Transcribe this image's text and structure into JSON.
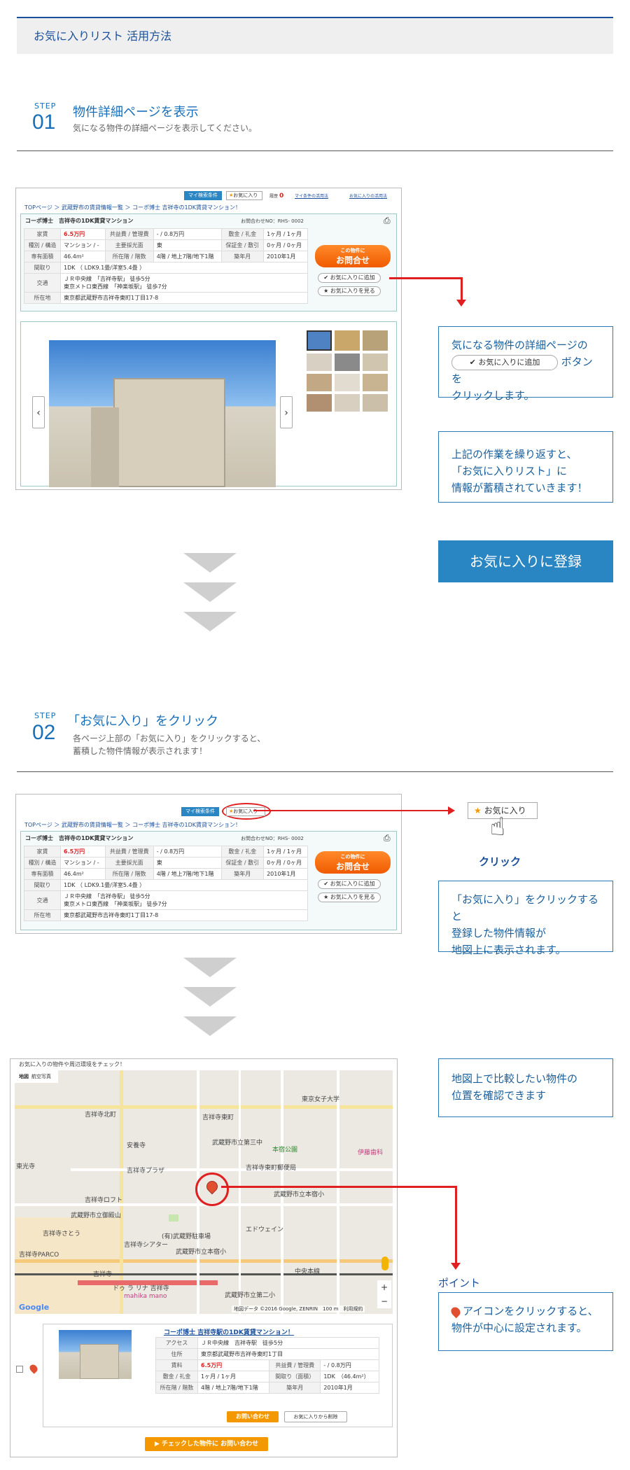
{
  "title": "お気に入りリスト 活用方法",
  "step1": {
    "label": "STEP",
    "num": "01",
    "heading": "物件詳細ページを表示",
    "sub": "気になる物件の詳細ページを表示してください。"
  },
  "step2": {
    "label": "STEP",
    "num": "02",
    "heading": "「お気に入り」をクリック",
    "sub1": "各ページ上部の「お気に入り」をクリックすると、",
    "sub2": "蓄積した物件情報が表示されます！"
  },
  "shot1": {
    "topbtn_my": "マイ検索条件",
    "topbtn_fav": "お気に入り",
    "topbtn_history": "履歴",
    "history_count": "0",
    "topbtn_mycond": "マイ条件の活用法",
    "topbtn_favuse": "お気に入りの活用法",
    "breadcrumb": "TOPページ ＞ 武蔵野市の賃貸情報一覧 ＞ コーポ博士 吉祥寺の1DK賃貸マンション！",
    "name": "コーポ博士　吉祥寺の1DK賃貸マンション",
    "inquiry_no": "お問合わせNO：RHS- 0002",
    "rent_lbl": "家賃",
    "rent": "6.5万円",
    "fee_lbl": "共益費 / 管理費",
    "fee": "- / 0.8万円",
    "deposit_lbl": "敷金 / 礼金",
    "deposit": "1ヶ月 / 1ヶ月",
    "type_lbl": "種別 / 構造",
    "type": "マンション / -",
    "dir_lbl": "主要採光面",
    "dir": "東",
    "guar_lbl": "保証金 / 敷引",
    "guar": "0ヶ月 / 0ヶ月",
    "area_lbl": "専有面積",
    "area": "46.4m²",
    "floor_lbl": "所在階 / 階数",
    "floor": "4階 / 地上7階/地下1階",
    "built_lbl": "築年月",
    "built": "2010年1月",
    "layout_lbl": "間取り",
    "layout": "1DK （ LDK9.1畳/洋室5.4畳 ）",
    "access_lbl": "交通",
    "access1": "ＪＲ中央線　「吉祥寺駅」 徒歩5分",
    "access2": "東京メトロ東西線　「神楽坂駅」 徒歩7分",
    "addr_lbl": "所在地",
    "addr": "東京都武蔵野市吉祥寺東町1丁目17-8",
    "cta_small": "この物件に",
    "cta": "お問合せ",
    "add_fav": "お気に入りに追加",
    "view_fav": "お気に入りを見る"
  },
  "info1": {
    "line1": "気になる物件の詳細ページの",
    "btn": "お気に入りに追加",
    "line2": "ボタンを",
    "line3": "クリックします。"
  },
  "info2": {
    "line1": "上記の作業を繰り返すと、",
    "line2": "「お気に入りリスト」に",
    "line3": "情報が蓄積されていきます！"
  },
  "register": "お気に入りに登録",
  "fav_btn": "お気に入り",
  "click_lbl": "クリック",
  "info3": {
    "line1": "「お気に入り」をクリックすると",
    "line2": "登録した物件情報が",
    "line3": "地図上に表示されます。"
  },
  "info4": {
    "line1": "地図上で比較したい物件の",
    "line2": "位置を確認できます"
  },
  "point_lbl": "ポイント",
  "info5": {
    "line1": "アイコンをクリックすると、",
    "line2": "物件が中心に設定されます。"
  },
  "map": {
    "caption": "お気に入りの物件や周辺環境をチェック！",
    "tab_map": "地図",
    "tab_photo": "航空写真",
    "copyright": "地図データ ©2016 Google, ZENRIN",
    "scale": "100 m",
    "terms": "利用規約",
    "google": "Google",
    "labels": [
      "東京女子大学",
      "吉祥寺北町",
      "吉祥寺東町",
      "安養寺",
      "武蔵野市立第三中",
      "本宿公園",
      "武蔵野市立本宿小",
      "吉祥寺プラザ",
      "吉祥寺東町郵便局",
      "吉祥寺ロフト",
      "吉祥寺さとう",
      "吉祥寺シアター",
      "中央本線",
      "吉祥寺",
      "(有)武蔵野駐車場",
      "武蔵野市立第二小",
      "エドウェイン",
      "吉祥寺PARCO",
      "ドゥ ラ リナ 吉祥寺",
      "mahika mano",
      "伊藤歯科",
      "武蔵野市立御殿山",
      "東光寺",
      "武蔵野市立本宿小"
    ]
  },
  "listing": {
    "title": "コーポ博士 吉祥寺駅の1DK賃貸マンション！",
    "access_lbl": "アクセス",
    "access": "ＪＲ中央線　吉祥寺駅　徒歩5分",
    "addr_lbl": "住所",
    "addr": "東京都武蔵野市吉祥寺東町1丁目",
    "rent_lbl": "賃料",
    "rent": "6.5万円",
    "fee_lbl": "共益費 / 管理費",
    "fee": "- / 0.8万円",
    "deposit_lbl": "敷金 / 礼金",
    "deposit": "1ヶ月 / 1ヶ月",
    "layout_lbl": "間取り（面積）",
    "layout": "1DK　（46.4m²）",
    "floor_lbl": "所在階 / 階数",
    "floor": "4階 / 地上7階/地下1階",
    "built_lbl": "築年月",
    "built": "2010年1月",
    "btn_inquiry": "お問い合わせ",
    "btn_remove": "お気に入りから削除"
  },
  "bottom_cta": "チェックした物件に お問い合わせ"
}
